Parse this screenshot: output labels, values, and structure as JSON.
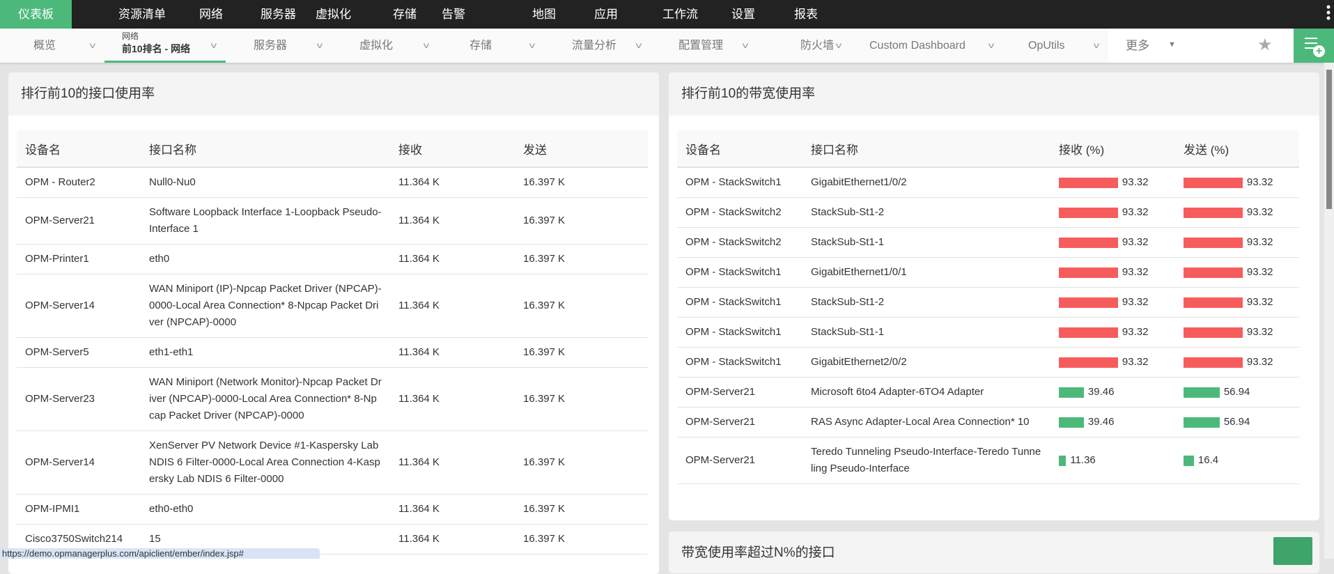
{
  "topnav": [
    "仪表板",
    "资源清单",
    "网络",
    "服务器",
    "虚拟化",
    "存储",
    "告警",
    "地图",
    "应用",
    "工作流",
    "设置",
    "报表"
  ],
  "subnav": {
    "items": [
      "概览",
      "服务器",
      "虚拟化",
      "存储",
      "流量分析",
      "配置管理",
      "防火墙",
      "Custom Dashboard",
      "OpUtils"
    ],
    "active_parent": "网络",
    "active_label": "前10排名 - 网络",
    "more": "更多"
  },
  "left_panel": {
    "title": "排行前10的接口使用率",
    "columns": [
      "设备名",
      "接口名称",
      "接收",
      "发送"
    ],
    "rows": [
      [
        "OPM - Router2",
        "Null0-Nu0",
        "11.364 K",
        "16.397 K"
      ],
      [
        "OPM-Server21",
        "Software Loopback Interface 1-Loopback Pseudo-Interface 1",
        "11.364 K",
        "16.397 K"
      ],
      [
        "OPM-Printer1",
        "eth0",
        "11.364 K",
        "16.397 K"
      ],
      [
        "OPM-Server14",
        "WAN Miniport (IP)-Npcap Packet Driver (NPCAP)-0000-Local Area Connection* 8-Npcap Packet Driver (NPCAP)-0000",
        "11.364 K",
        "16.397 K"
      ],
      [
        "OPM-Server5",
        "eth1-eth1",
        "11.364 K",
        "16.397 K"
      ],
      [
        "OPM-Server23",
        "WAN Miniport (Network Monitor)-Npcap Packet Driver (NPCAP)-0000-Local Area Connection* 8-Npcap Packet Driver (NPCAP)-0000",
        "11.364 K",
        "16.397 K"
      ],
      [
        "OPM-Server14",
        "XenServer PV Network Device #1-Kaspersky Lab NDIS 6 Filter-0000-Local Area Connection 4-Kaspersky Lab NDIS 6 Filter-0000",
        "11.364 K",
        "16.397 K"
      ],
      [
        "OPM-IPMI1",
        "eth0-eth0",
        "11.364 K",
        "16.397 K"
      ],
      [
        "Cisco3750Switch214",
        "15",
        "11.364 K",
        "16.397 K"
      ]
    ]
  },
  "right_panel": {
    "title": "排行前10的带宽使用率",
    "columns": [
      "设备名",
      "接口名称",
      "接收 (%)",
      "发送 (%)"
    ],
    "rows": [
      [
        "OPM - StackSwitch1",
        "GigabitEthernet1/0/2",
        "93.32",
        "93.32"
      ],
      [
        "OPM - StackSwitch2",
        "StackSub-St1-2",
        "93.32",
        "93.32"
      ],
      [
        "OPM - StackSwitch2",
        "StackSub-St1-1",
        "93.32",
        "93.32"
      ],
      [
        "OPM - StackSwitch1",
        "GigabitEthernet1/0/1",
        "93.32",
        "93.32"
      ],
      [
        "OPM - StackSwitch1",
        "StackSub-St1-2",
        "93.32",
        "93.32"
      ],
      [
        "OPM - StackSwitch1",
        "StackSub-St1-1",
        "93.32",
        "93.32"
      ],
      [
        "OPM - StackSwitch1",
        "GigabitEthernet2/0/2",
        "93.32",
        "93.32"
      ],
      [
        "OPM-Server21",
        "Microsoft 6to4 Adapter-6TO4 Adapter",
        "39.46",
        "56.94"
      ],
      [
        "OPM-Server21",
        "RAS Async Adapter-Local Area Connection* 10",
        "39.46",
        "56.94"
      ],
      [
        "OPM-Server21",
        "Teredo Tunneling Pseudo-Interface-Teredo Tunneling Pseudo-Interface",
        "11.36",
        "16.4"
      ]
    ],
    "colors": {
      "high": "#f75c5c",
      "normal": "#4cb97b"
    }
  },
  "bottom_panel": {
    "title": "带宽使用率超过N%的接口"
  },
  "status_url": "https://demo.opmanagerplus.com/apiclient/ember/index.jsp#"
}
